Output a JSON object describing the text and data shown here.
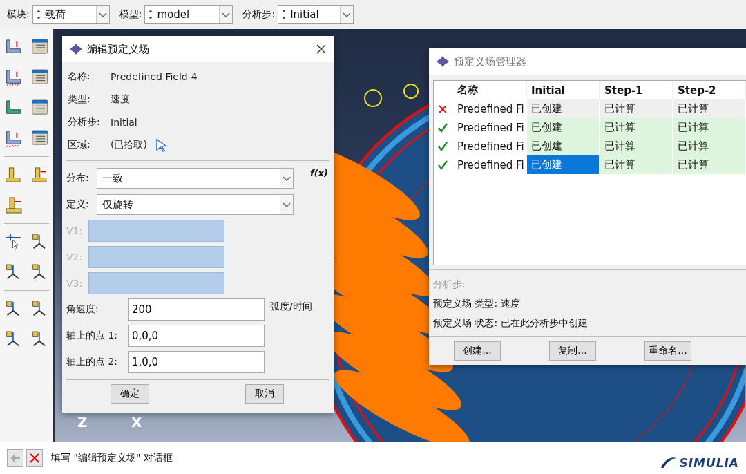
{
  "context_bar": {
    "fields": [
      {
        "label": "模块:",
        "value": "载荷"
      },
      {
        "label": "模型:",
        "value": "model"
      },
      {
        "label": "分析步:",
        "value": "Initial"
      }
    ]
  },
  "viewport": {
    "triad_labels": [
      "Z",
      "X"
    ]
  },
  "edit_dialog": {
    "title": "编辑预定义场",
    "info": [
      {
        "kind": "text",
        "label": "名称:",
        "value": "Predefined Field-4"
      },
      {
        "kind": "text",
        "label": "类型:",
        "value": "速度"
      },
      {
        "kind": "text",
        "label": "分析步:",
        "value": "Initial"
      },
      {
        "kind": "pick",
        "label": "区域:",
        "value": "(已拾取)"
      }
    ],
    "distribution": {
      "label": "分布:",
      "value": "一致",
      "fx": "f(x)"
    },
    "definition": {
      "label": "定义:",
      "value": "仅旋转"
    },
    "vectors": [
      {
        "label": "V1:",
        "disabled": true
      },
      {
        "label": "V2:",
        "disabled": true
      },
      {
        "label": "V3:",
        "disabled": true
      }
    ],
    "angular_velocity": {
      "label": "角速度:",
      "value": "200",
      "unit": "弧度/时间"
    },
    "axis_points": [
      {
        "label": "轴上的点 1:",
        "value": "0,0,0"
      },
      {
        "label": "轴上的点 2:",
        "value": "1,0,0"
      }
    ],
    "buttons": [
      "确定",
      "取消"
    ]
  },
  "manager": {
    "title": "预定义场管理器",
    "columns": [
      "名称",
      "Initial",
      "Step-1",
      "Step-2"
    ],
    "rows": [
      {
        "active": false,
        "cells": [
          {
            "text": "Predefined Fi",
            "selected": false
          },
          {
            "text": "已创建",
            "selected": false
          },
          {
            "text": "已计算",
            "selected": false
          },
          {
            "text": "已计算",
            "selected": false
          }
        ]
      },
      {
        "active": true,
        "cells": [
          {
            "text": "Predefined Fi",
            "selected": false
          },
          {
            "text": "已创建",
            "selected": false
          },
          {
            "text": "已计算",
            "selected": false
          },
          {
            "text": "已计算",
            "selected": false
          }
        ]
      },
      {
        "active": true,
        "cells": [
          {
            "text": "Predefined Fi",
            "selected": false
          },
          {
            "text": "已创建",
            "selected": false
          },
          {
            "text": "已计算",
            "selected": false
          },
          {
            "text": "已计算",
            "selected": false
          }
        ]
      },
      {
        "active": true,
        "cells": [
          {
            "text": "Predefined Fi",
            "selected": false
          },
          {
            "text": "已创建",
            "selected": true
          },
          {
            "text": "已计算",
            "selected": false
          },
          {
            "text": "已计算",
            "selected": false
          }
        ]
      }
    ],
    "step_label": "分析步:",
    "info": [
      "预定义场 类型: 速度",
      "预定义场 状态: 已在此分析步中创建"
    ],
    "buttons": [
      "创建...",
      "复制...",
      "重命名..."
    ]
  },
  "status_bar": {
    "prompt": "填写 \"编辑预定义场\" 对话框",
    "logo": "SIMULIA"
  }
}
